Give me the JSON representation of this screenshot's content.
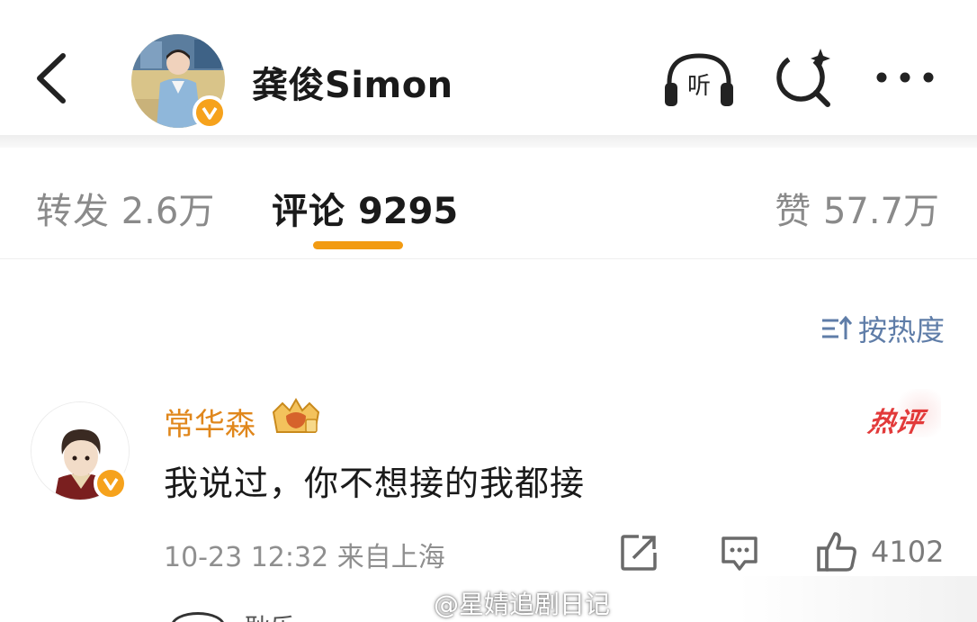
{
  "header": {
    "title": "龚俊Simon",
    "back_icon": "chevron-left-icon",
    "listen_label": "听",
    "search_icon": "search-sparkle-icon",
    "more_icon": "more-dots-icon"
  },
  "tabs": [
    {
      "label": "转发",
      "count": "2.6万",
      "active": false
    },
    {
      "label": "评论",
      "count": "9295",
      "active": true
    },
    {
      "label": "赞",
      "count": "57.7万",
      "active": false
    }
  ],
  "sort": {
    "label": "按热度",
    "icon": "sort-icon"
  },
  "comment": {
    "username": "常华森",
    "badge_icon": "crown-badge-icon",
    "hot_label": "热评",
    "text": "我说过，你不想接的我都接",
    "time": "10-23 12:32",
    "location": "来自上海",
    "like_count": "4102"
  },
  "next_reply": {
    "username": "耿乐"
  },
  "watermark": {
    "text": "@星婧追剧日记"
  },
  "colors": {
    "accent_orange": "#f29b12",
    "username_orange": "#e0871c",
    "hot_red": "#e23a3a",
    "sort_blue": "#5f7da8",
    "verified_gold": "#f6a21c"
  }
}
